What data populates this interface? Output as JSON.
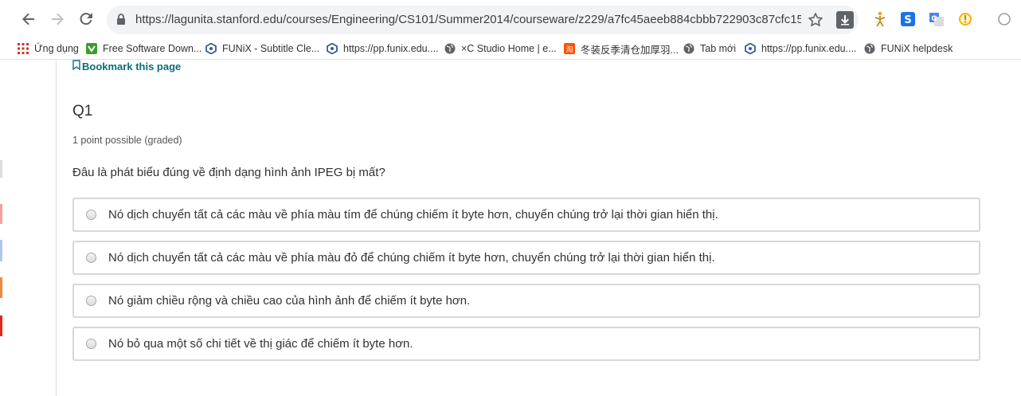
{
  "browser": {
    "url": "https://lagunita.stanford.edu/courses/Engineering/CS101/Summer2014/courseware/z229/a7fc45aeeb884cbbb722903c87cfc158/?acti..."
  },
  "bookmarks_bar": {
    "items": [
      {
        "label": "Ứng dụng",
        "icon": "apps-grid-icon"
      },
      {
        "label": "Free Software Down...",
        "icon": "download-arrow-icon"
      },
      {
        "label": "FUNiX - Subtitle Cle...",
        "icon": "funix-hex-icon"
      },
      {
        "label": "https://pp.funix.edu....",
        "icon": "funix-hex-icon"
      },
      {
        "label": "×C Studio Home | e...",
        "icon": "globe-icon"
      },
      {
        "label": "冬装反季清仓加厚羽...",
        "icon": "shop-icon"
      },
      {
        "label": "Tab mới",
        "icon": "globe-icon"
      },
      {
        "label": "https://pp.funix.edu....",
        "icon": "funix-hex-icon"
      },
      {
        "label": "FUNiX helpdesk",
        "icon": "globe-icon"
      }
    ]
  },
  "page": {
    "bookmark_link": "Bookmark this page",
    "question": {
      "title": "Q1",
      "points": "1 point possible (graded)",
      "text": "Đâu là phát biểu đúng về định dạng hình ảnh IPEG bị mất?",
      "options": [
        "Nó dịch chuyển tất cả các màu về phía màu tím để chúng chiếm ít byte hơn, chuyển chúng trở lại thời gian hiển thị.",
        "Nó dịch chuyển tất cả các màu về phía màu đỏ để chúng chiếm ít byte hơn, chuyển chúng trở lại thời gian hiển thị.",
        "Nó giảm chiều rộng và chiều cao của hình ảnh để chiếm ít byte hơn.",
        "Nó bỏ qua một số chi tiết về thị giác để chiếm ít byte hơn."
      ]
    }
  },
  "colors": {
    "link": "#0a6e77",
    "option_border": "#d7d7d7",
    "text": "#313131"
  }
}
